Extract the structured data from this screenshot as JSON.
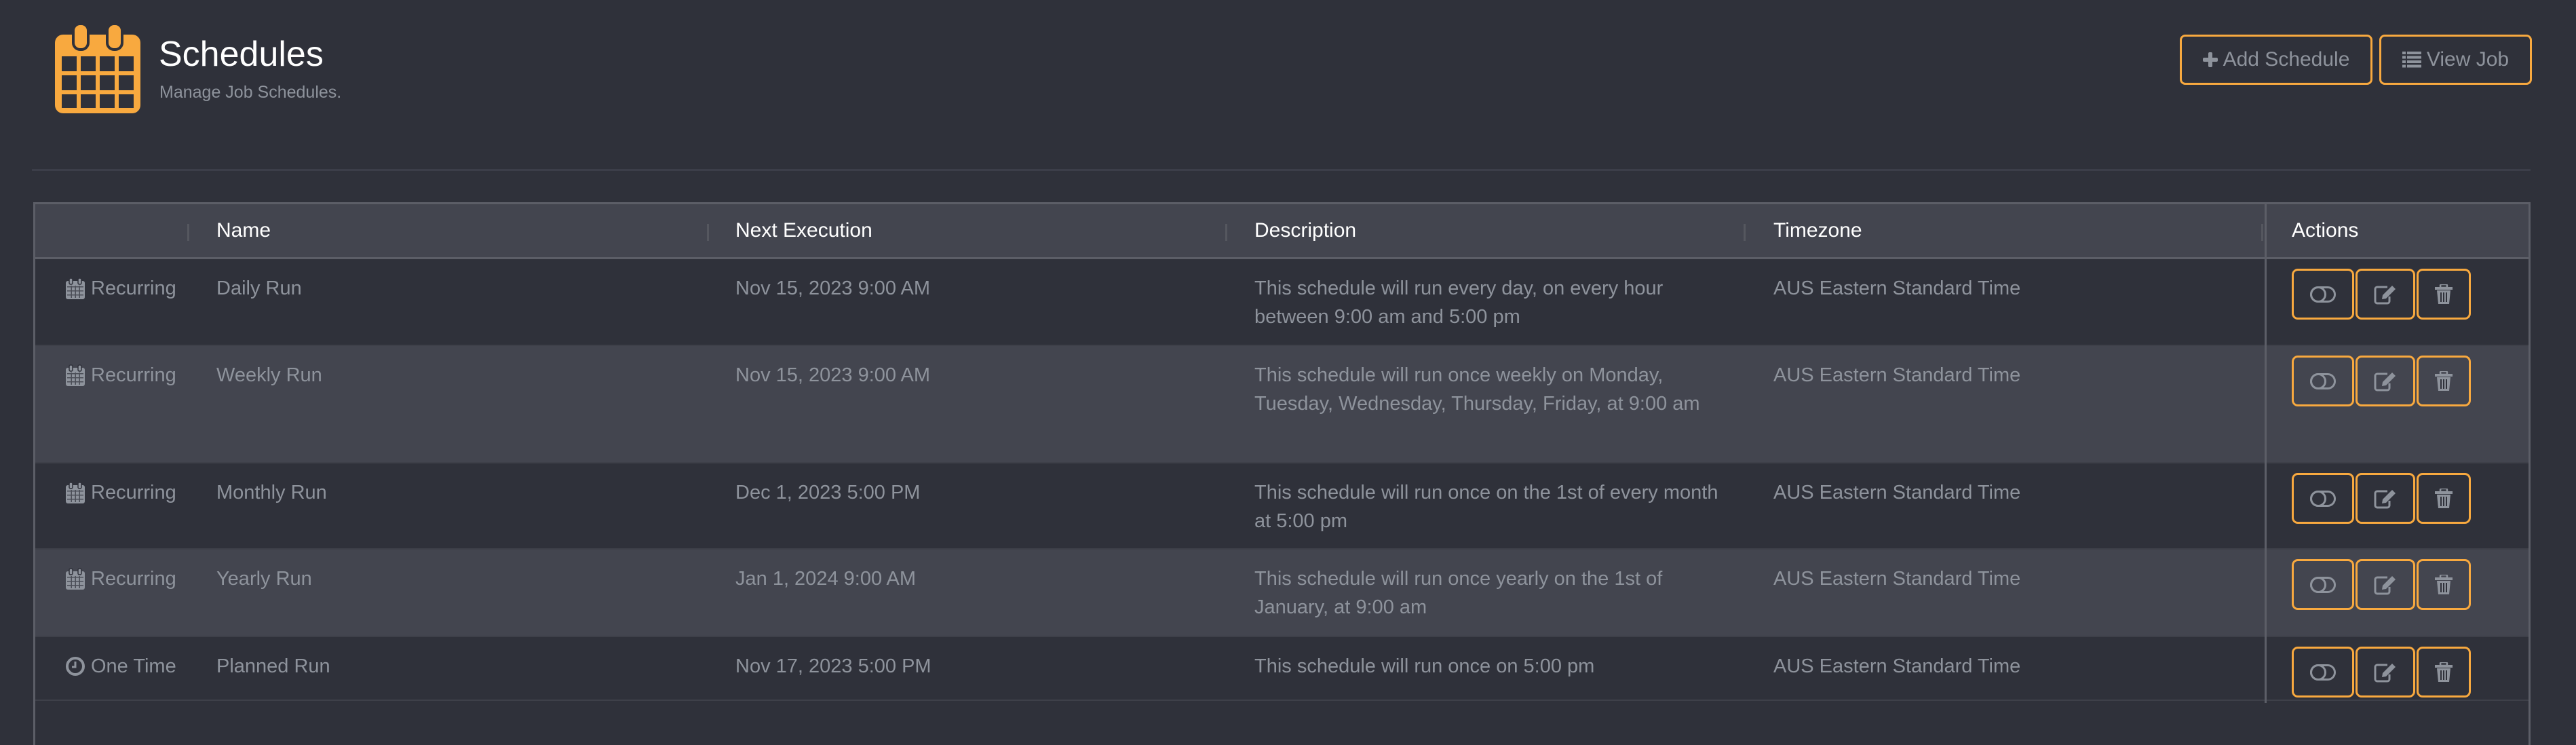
{
  "header": {
    "icon": "calendar-icon",
    "title": "Schedules",
    "subtitle": "Manage Job Schedules.",
    "buttons": {
      "add_schedule": {
        "label": "Add Schedule",
        "icon": "plus-icon"
      },
      "view_job": {
        "label": "View Job",
        "icon": "list-icon"
      }
    }
  },
  "colors": {
    "accent": "#f8a93f",
    "background": "#2f313a",
    "header_row": "#43454f",
    "text_muted": "#8e939c",
    "text_header": "#ffffff"
  },
  "table": {
    "columns": [
      "",
      "Name",
      "Next Execution",
      "Description",
      "Timezone",
      "Actions"
    ],
    "rows": [
      {
        "type": "Recurring",
        "type_icon": "calendar-icon",
        "name": "Daily Run",
        "next_execution": "Nov 15, 2023 9:00 AM",
        "description": "This schedule will run every day, on every hour between 9:00 am and 5:00 pm",
        "timezone": "AUS Eastern Standard Time"
      },
      {
        "type": "Recurring",
        "type_icon": "calendar-icon",
        "name": "Weekly Run",
        "next_execution": "Nov 15, 2023 9:00 AM",
        "description": "This schedule will run once weekly on Monday, Tuesday, Wednesday, Thursday, Friday, at 9:00 am",
        "timezone": "AUS Eastern Standard Time"
      },
      {
        "type": "Recurring",
        "type_icon": "calendar-icon",
        "name": "Monthly Run",
        "next_execution": "Dec 1, 2023 5:00 PM",
        "description": "This schedule will run once on the 1st of every month at 5:00 pm",
        "timezone": "AUS Eastern Standard Time"
      },
      {
        "type": "Recurring",
        "type_icon": "calendar-icon",
        "name": "Yearly Run",
        "next_execution": "Jan 1, 2024 9:00 AM",
        "description": "This schedule will run once yearly on the 1st of January, at 9:00 am",
        "timezone": "AUS Eastern Standard Time"
      },
      {
        "type": "One Time",
        "type_icon": "clock-icon",
        "name": "Planned Run",
        "next_execution": "Nov 17, 2023 5:00 PM",
        "description": "This schedule will run once on 5:00 pm",
        "timezone": "AUS Eastern Standard Time"
      }
    ],
    "row_actions": [
      {
        "name": "toggle",
        "icon": "toggle-icon"
      },
      {
        "name": "edit",
        "icon": "edit-icon"
      },
      {
        "name": "delete",
        "icon": "trash-icon"
      }
    ]
  }
}
